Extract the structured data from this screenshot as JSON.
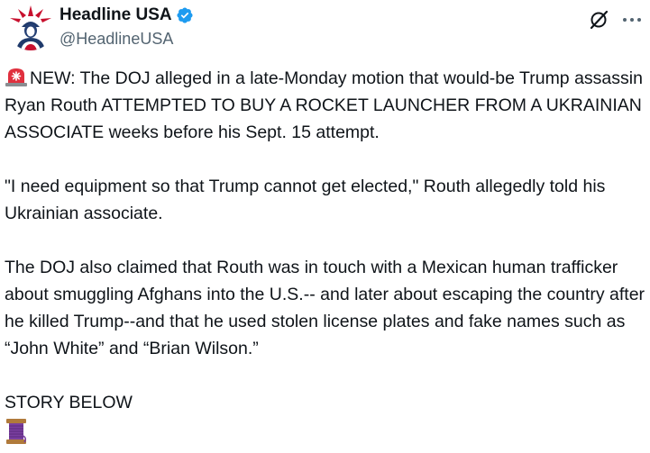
{
  "author": {
    "display_name": "Headline USA",
    "handle": "@HeadlineUSA",
    "verified": true,
    "avatar_icon": "statue-of-liberty-logo"
  },
  "actions": {
    "grok_icon": "grok-slash-circle-icon",
    "more_icon": "more-dots-icon"
  },
  "colors": {
    "verified_blue": "#1d9bf0",
    "text": "#0f1419",
    "secondary_text": "#536471"
  },
  "tweet": {
    "siren_emoji": "police-siren-emoji",
    "para1": "NEW: The DOJ alleged in a late-Monday motion that would-be Trump assassin Ryan Routh ATTEMPTED TO BUY A ROCKET LAUNCHER FROM A UKRAINIAN ASSOCIATE weeks before his Sept. 15 attempt.",
    "para2": "\"I need equipment so that Trump cannot get elected,\" Routh allegedly told his Ukrainian associate.",
    "para3": "The DOJ also claimed that Routh was in touch with a Mexican human trafficker about smuggling Afghans into the U.S.-- and later about escaping the country after he killed Trump--and that he used stolen license plates and fake names such as “John White” and “Brian Wilson.”",
    "para4": "STORY BELOW",
    "thread_emoji": "thread-spool-emoji"
  }
}
